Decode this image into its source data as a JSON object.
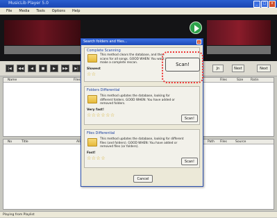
{
  "app": {
    "title": "MusicLib Player 5.0",
    "status": "Playing from Playlist"
  },
  "menu": [
    "File",
    "Media",
    "Tools",
    "Options",
    "Help"
  ],
  "transport": {
    "buttons": [
      "|◀",
      "◀◀",
      "◀",
      "■",
      "▶",
      "▶▶",
      "▶|"
    ]
  },
  "side_buttons": {
    "b1": "Jn",
    "b2": "Next",
    "b3": "Next"
  },
  "library": {
    "headers": {
      "name": "Name",
      "file": "Files",
      "files": "Files",
      "size": "Size",
      "rating": "Ratin"
    }
  },
  "playlist": {
    "headers": {
      "no": "No",
      "title": "Title",
      "album": "Albu",
      "path": "Path",
      "files": "Files",
      "source": "Source"
    }
  },
  "dialog": {
    "title": "Search folders and files...",
    "close": "x",
    "complete": {
      "label": "Complete Scanning",
      "desc": "This method clears the database, and then scans for all songs. GOOD WHEN: You want to make a complete rescan.",
      "rating_label": "Slowest",
      "stars": "☆☆",
      "button": "Scan!"
    },
    "folders": {
      "label": "Folders Differential",
      "desc": "This method updates the database, looking for different folders. GOOD WHEN: You have added or removed folders.",
      "rating_label": "Very fast!",
      "stars": "☆☆☆☆☆☆",
      "button": "Scan!"
    },
    "files": {
      "label": "Files Differential",
      "desc": "This method updates the database, looking for different files (and folders). GOOD WHEN: You have added or removed files (or folders).",
      "rating_label": "Fast!",
      "stars": "☆☆☆☆",
      "button": "Scan!"
    },
    "cancel": "Cancel"
  }
}
